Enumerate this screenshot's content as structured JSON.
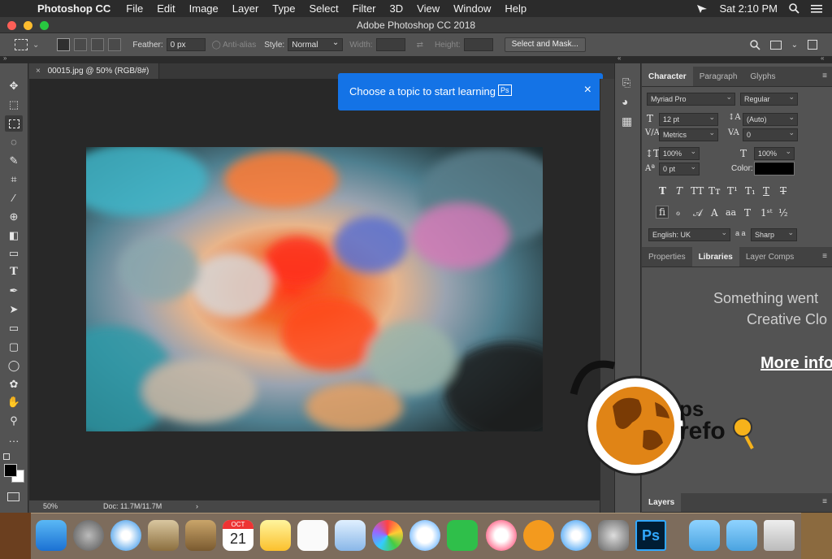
{
  "menubar": {
    "app": "Photoshop CC",
    "menus": [
      "File",
      "Edit",
      "Image",
      "Layer",
      "Type",
      "Select",
      "Filter",
      "3D",
      "View",
      "Window",
      "Help"
    ],
    "clock": "Sat 2:10 PM"
  },
  "window": {
    "title": "Adobe Photoshop CC 2018"
  },
  "options": {
    "feather_label": "Feather:",
    "feather_value": "0 px",
    "antialias_label": "Anti-alias",
    "style_label": "Style:",
    "style_value": "Normal",
    "width_label": "Width:",
    "height_label": "Height:",
    "select_mask": "Select and Mask..."
  },
  "document": {
    "tab_label": "00015.jpg @ 50% (RGB/8#)",
    "zoom": "50%",
    "doc_info": "Doc: 11.7M/11.7M"
  },
  "tooltip": {
    "text": "Choose a topic to start learning",
    "badge": "Ps"
  },
  "character": {
    "tabs": [
      "Character",
      "Paragraph",
      "Glyphs"
    ],
    "font_family": "Myriad Pro",
    "font_style": "Regular",
    "font_size": "12 pt",
    "leading": "(Auto)",
    "kerning": "Metrics",
    "tracking": "0",
    "vertical_scale": "100%",
    "horizontal_scale": "100%",
    "baseline_shift": "0 pt",
    "color_label": "Color:",
    "language": "English: UK",
    "aa_label": "a a",
    "antialias": "Sharp",
    "color": "#000000"
  },
  "libraries": {
    "tabs": [
      "Properties",
      "Libraries",
      "Layer Comps"
    ],
    "error_line1": "Something went",
    "error_line2": "Creative Clo",
    "more_info": "More info"
  },
  "layers": {
    "tab": "Layers"
  },
  "watermark": {
    "text": "ps refo"
  },
  "dock": {
    "calendar_month": "OCT",
    "calendar_day": "21",
    "ps_label": "Ps"
  },
  "colors": {
    "accent": "#1473e6",
    "panel": "#535353",
    "canvas": "#282828"
  }
}
